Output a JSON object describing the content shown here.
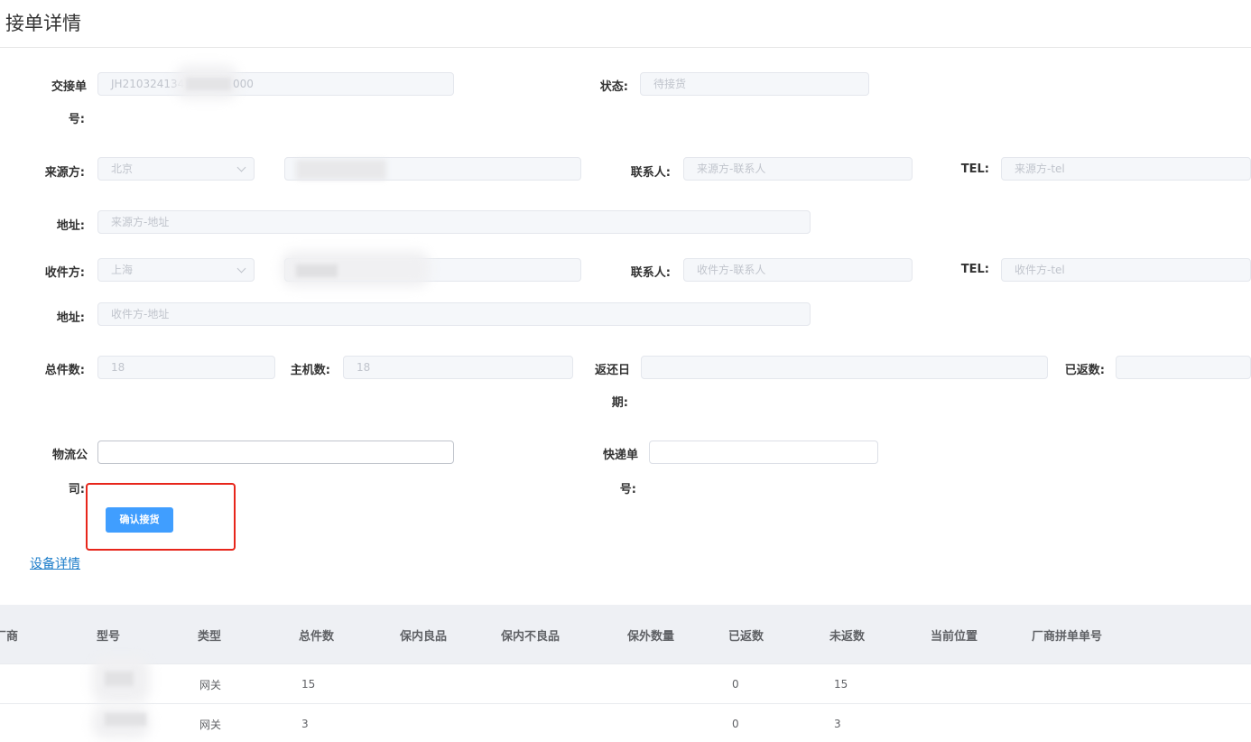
{
  "page": {
    "title": "接单详情"
  },
  "form": {
    "order_no": {
      "label_l1": "交接单",
      "label_l2": "号:",
      "value": "JH210324134",
      "value_tail": "000"
    },
    "status": {
      "label": "状态:",
      "placeholder": "待接货"
    },
    "source": {
      "label": "来源方:",
      "select_value": "北京",
      "contact_label": "联系人:",
      "contact_placeholder": "来源方-联系人",
      "tel_label": "TEL:",
      "tel_placeholder": "来源方-tel",
      "address_label": "地址:",
      "address_placeholder": "来源方-地址"
    },
    "receiver": {
      "label": "收件方:",
      "select_value": "上海",
      "contact_label": "联系人:",
      "contact_placeholder": "收件方-联系人",
      "tel_label": "TEL:",
      "tel_placeholder": "收件方-tel",
      "address_label": "地址:",
      "address_placeholder": "收件方-地址"
    },
    "total": {
      "label": "总件数:",
      "value": "18"
    },
    "host": {
      "label": "主机数:",
      "value": "18"
    },
    "return_date": {
      "label_l1": "返还日",
      "label_l2": "期:"
    },
    "returned": {
      "label": "已返数:"
    },
    "logistics": {
      "label_l1": "物流公",
      "label_l2": "司:"
    },
    "express": {
      "label_l1": "快递单",
      "label_l2": "号:"
    },
    "confirm_button": "确认接货",
    "device_link": "设备详情"
  },
  "table": {
    "columns": [
      "厂商",
      "型号",
      "类型",
      "总件数",
      "保内良品",
      "保内不良品",
      "保外数量",
      "已返数",
      "未返数",
      "当前位置",
      "厂商拼单单号"
    ],
    "rows": [
      {
        "type": "网关",
        "total": "15",
        "returned": "0",
        "not_returned": "15"
      },
      {
        "type": "网关",
        "total": "3",
        "returned": "0",
        "not_returned": "3"
      }
    ]
  }
}
